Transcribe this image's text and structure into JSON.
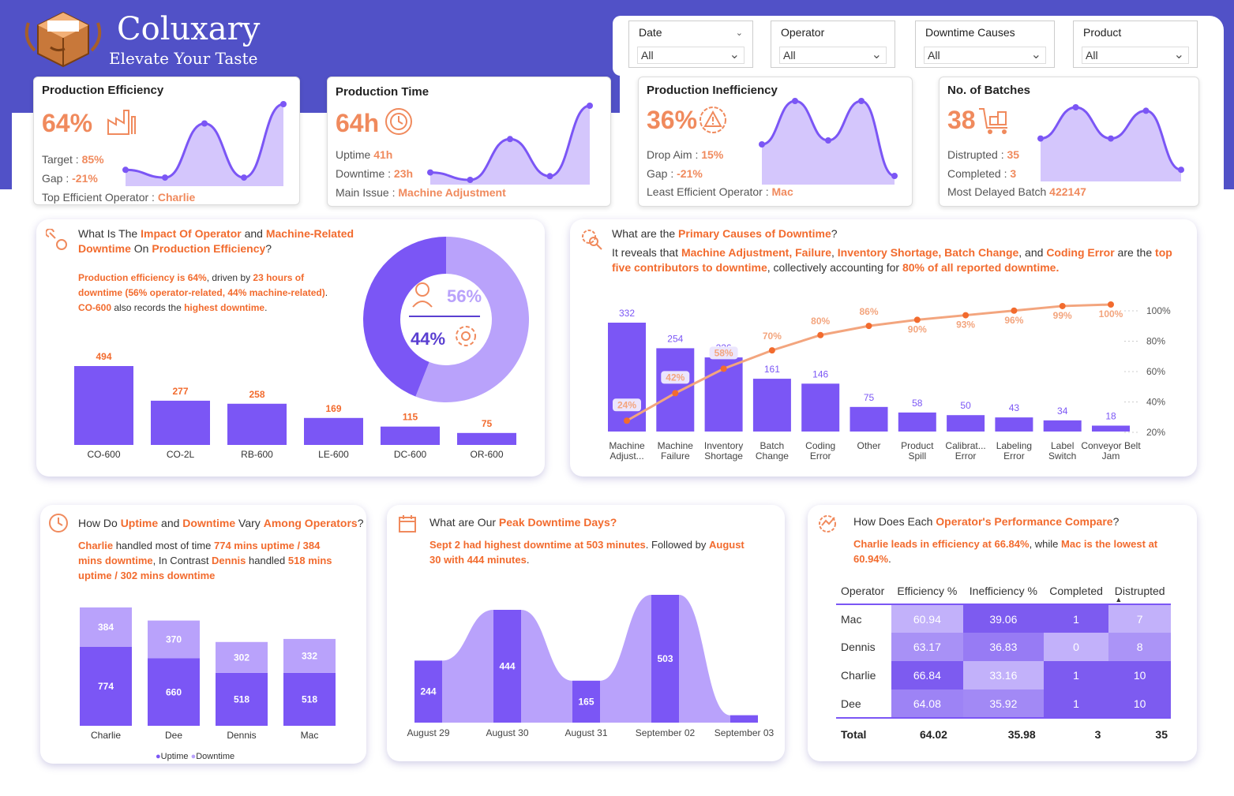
{
  "brand": {
    "name": "Coluxary",
    "tagline": "Elevate Your Taste"
  },
  "colors": {
    "primary": "#7b56f5",
    "light": "#b9a2fb",
    "accent": "#f26b2e",
    "header": "#5151c7"
  },
  "filters": [
    {
      "label": "Date",
      "value": "All"
    },
    {
      "label": "Operator",
      "value": "All"
    },
    {
      "label": "Downtime Causes",
      "value": "All"
    },
    {
      "label": "Product",
      "value": "All"
    }
  ],
  "kpis": {
    "efficiency": {
      "title": "Production Efficiency",
      "value": "64%",
      "l1": "Target : ",
      "v1": "85%",
      "l2": "Gap : ",
      "v2": "-21%",
      "l3": "Top Efficient Operator : ",
      "v3": "Charlie",
      "icon": "factory-icon"
    },
    "time": {
      "title": "Production Time",
      "value": "64h",
      "l1": "Uptime ",
      "v1": "41h",
      "l2": "Downtime : ",
      "v2": "23h",
      "l3": "Main Issue : ",
      "v3": "Machine Adjustment",
      "icon": "clock-gear-icon"
    },
    "inefficiency": {
      "title": "Production Inefficiency",
      "value": "36%",
      "l1": "Drop Aim : ",
      "v1": "15%",
      "l2": "Gap : ",
      "v2": "-21%",
      "l3": "Least Efficient Operator : ",
      "v3": "Mac",
      "icon": "warning-gear-icon"
    },
    "batches": {
      "title": "No. of Batches",
      "value": "38",
      "l1": "Distrupted : ",
      "v1": "35",
      "l2": "Completed : ",
      "v2": "3",
      "l3": "Most Delayed Batch ",
      "v3": "422147",
      "icon": "cart-boxes-icon"
    }
  },
  "impact": {
    "q": [
      "What Is The ",
      "Impact Of Operator",
      " and ",
      "Machine-Related",
      "Downtime",
      " On ",
      "Production Efficiency",
      "?"
    ],
    "note": [
      "Production efficiency is 64%",
      ", driven by ",
      "23 hours of",
      "downtime (56% operator-related, 44% machine-related)",
      ".",
      "CO-600",
      " also records the ",
      "highest downtime",
      "."
    ],
    "donut": {
      "operator_pct": "56%",
      "machine_pct": "44%"
    }
  },
  "causes": {
    "q": [
      "What are the ",
      "Primary Causes of Downtime",
      "?"
    ],
    "note": [
      "It reveals that ",
      "Machine Adjustment, Failure",
      ", ",
      "Inventory Shortage, Batch Change",
      ", and ",
      "Coding Error",
      " are the ",
      "top",
      "five contributors to downtime",
      ", collectively accounting for ",
      "80% of all reported downtime."
    ]
  },
  "operators_q": {
    "q": [
      "How Do ",
      "Uptime",
      " and ",
      "Downtime",
      " Vary ",
      "Among Operators",
      "?"
    ],
    "note": [
      "Charlie",
      " handled most of time ",
      "774 mins uptime / 384",
      "mins downtime",
      ", In Contrast ",
      "Dennis",
      " handled ",
      "518 mins",
      "uptime / 302 mins downtime"
    ],
    "legend": [
      "Uptime",
      "Downtime"
    ]
  },
  "peak": {
    "q": [
      "What are Our ",
      "Peak Downtime Days?"
    ],
    "note": [
      "Sept 2 had highest downtime at 503 minutes",
      ". Followed by ",
      "August",
      "30 with 444 minutes",
      "."
    ]
  },
  "perf": {
    "q": [
      "How Does Each ",
      "Operator's Performance Compare",
      "?"
    ],
    "note": [
      "Charlie leads in efficiency at 66.84%",
      ", while ",
      "Mac is the lowest at",
      "60.94%",
      "."
    ],
    "headers": [
      "Operator",
      "Efficiency %",
      "Inefficiency %",
      "Completed",
      "Distrupted"
    ],
    "rows": [
      [
        "Mac",
        "60.94",
        "39.06",
        "1",
        "7"
      ],
      [
        "Dennis",
        "63.17",
        "36.83",
        "0",
        "8"
      ],
      [
        "Charlie",
        "66.84",
        "33.16",
        "1",
        "10"
      ],
      [
        "Dee",
        "64.08",
        "35.92",
        "1",
        "10"
      ]
    ],
    "total": [
      "Total",
      "64.02",
      "35.98",
      "3",
      "35"
    ]
  },
  "chart_data": [
    {
      "id": "spark_efficiency",
      "type": "area",
      "values": [
        0.15,
        0.05,
        0.75,
        0.05,
        1.0
      ]
    },
    {
      "id": "spark_time",
      "type": "area",
      "values": [
        0.1,
        0.0,
        0.55,
        0.05,
        1.0
      ]
    },
    {
      "id": "spark_inefficiency",
      "type": "area",
      "values": [
        0.45,
        1.0,
        0.5,
        1.0,
        0.05
      ]
    },
    {
      "id": "spark_batches",
      "type": "area",
      "values": [
        0.55,
        1.0,
        0.55,
        0.95,
        0.1
      ]
    },
    {
      "id": "machine_downtime",
      "type": "bar",
      "categories": [
        "CO-600",
        "CO-2L",
        "RB-600",
        "LE-600",
        "DC-600",
        "OR-600"
      ],
      "values": [
        494,
        277,
        258,
        169,
        115,
        75
      ]
    },
    {
      "id": "operator_split",
      "type": "pie",
      "categories": [
        "Operator",
        "Machine"
      ],
      "values": [
        56,
        44
      ]
    },
    {
      "id": "downtime_causes",
      "type": "bar",
      "categories": [
        "Machine Adjust...",
        "Machine Failure",
        "Inventory Shortage",
        "Batch Change",
        "Coding Error",
        "Other",
        "Product Spill",
        "Calibrat... Error",
        "Labeling Error",
        "Label Switch",
        "Conveyor Belt Jam"
      ],
      "values": [
        332,
        254,
        226,
        161,
        146,
        75,
        58,
        50,
        43,
        34,
        18
      ],
      "cumulative_pct": [
        24,
        42,
        58,
        70,
        80,
        86,
        90,
        93,
        96,
        99,
        100
      ],
      "y2_ticks": [
        "100%",
        "80%",
        "60%",
        "40%",
        "20%"
      ]
    },
    {
      "id": "operator_time",
      "type": "bar",
      "categories": [
        "Charlie",
        "Dee",
        "Dennis",
        "Mac"
      ],
      "series": [
        {
          "name": "Uptime",
          "values": [
            774,
            660,
            518,
            518
          ]
        },
        {
          "name": "Downtime",
          "values": [
            384,
            370,
            302,
            332
          ]
        }
      ]
    },
    {
      "id": "peak_days",
      "type": "area",
      "categories": [
        "August 29",
        "August 30",
        "August 31",
        "September 02",
        "September 03"
      ],
      "values": [
        244,
        444,
        165,
        503,
        29
      ]
    }
  ]
}
